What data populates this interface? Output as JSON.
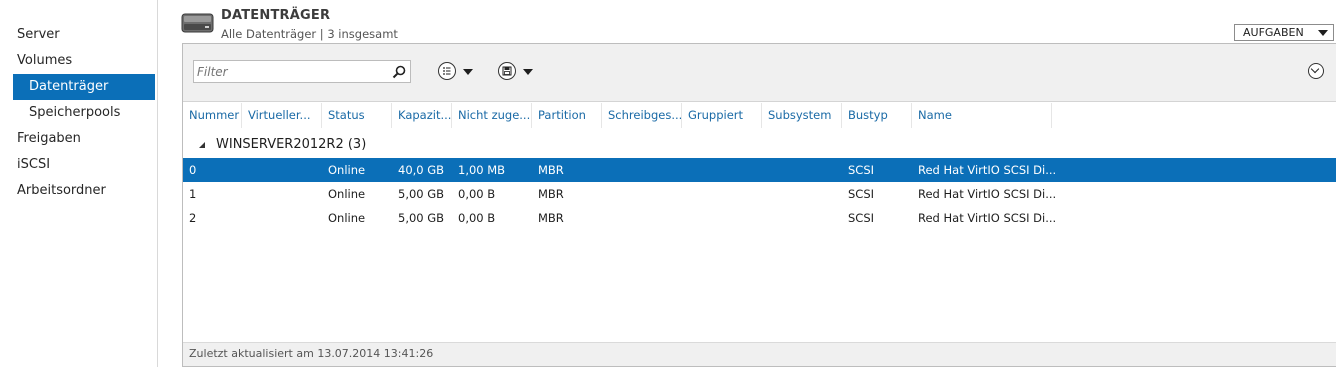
{
  "sidebar": {
    "items": [
      {
        "label": "Server",
        "selected": false
      },
      {
        "label": "Volumes",
        "selected": false
      },
      {
        "label": "Datenträger",
        "selected": true
      },
      {
        "label": "Speicherpools",
        "selected": false
      },
      {
        "label": "Freigaben",
        "selected": false
      },
      {
        "label": "iSCSI",
        "selected": false
      },
      {
        "label": "Arbeitsordner",
        "selected": false
      }
    ]
  },
  "header": {
    "icon": "disk-drive-icon",
    "title": "DATENTRÄGER",
    "subtitle": "Alle Datenträger | 3 insgesamt",
    "tasks_label": "AUFGABEN"
  },
  "toolbar": {
    "filter_placeholder": "Filter",
    "view_icon": "list-options-icon",
    "save_icon": "save-icon",
    "expand_icon": "chevron-down-circle-icon"
  },
  "table": {
    "columns": [
      "Nummer",
      "Virtueller...",
      "Status",
      "Kapazit...",
      "Nicht zuge...",
      "Partition",
      "Schreibges...",
      "Gruppiert",
      "Subsystem",
      "Bustyp",
      "Name"
    ],
    "group": {
      "label": "WINSERVER2012R2 (3)"
    },
    "rows": [
      {
        "Nummer": "0",
        "Virtueller": "",
        "Status": "Online",
        "Kapazitaet": "40,0 GB",
        "NichtZugeordnet": "1,00 MB",
        "Partition": "MBR",
        "Schreibgeschuetzt": "",
        "Gruppiert": "",
        "Subsystem": "",
        "Bustyp": "SCSI",
        "Name": "Red Hat VirtIO SCSI Di...",
        "selected": true
      },
      {
        "Nummer": "1",
        "Virtueller": "",
        "Status": "Online",
        "Kapazitaet": "5,00 GB",
        "NichtZugeordnet": "0,00 B",
        "Partition": "MBR",
        "Schreibgeschuetzt": "",
        "Gruppiert": "",
        "Subsystem": "",
        "Bustyp": "SCSI",
        "Name": "Red Hat VirtIO SCSI Di...",
        "selected": false
      },
      {
        "Nummer": "2",
        "Virtueller": "",
        "Status": "Online",
        "Kapazitaet": "5,00 GB",
        "NichtZugeordnet": "0,00 B",
        "Partition": "MBR",
        "Schreibgeschuetzt": "",
        "Gruppiert": "",
        "Subsystem": "",
        "Bustyp": "SCSI",
        "Name": "Red Hat VirtIO SCSI Di...",
        "selected": false
      }
    ]
  },
  "statusbar": {
    "text": "Zuletzt aktualisiert am 13.07.2014 13:41:26"
  },
  "colors": {
    "accent": "#0b6fb8",
    "column_header": "#1a6aa6",
    "toolbar_bg": "#f0f0f0"
  }
}
